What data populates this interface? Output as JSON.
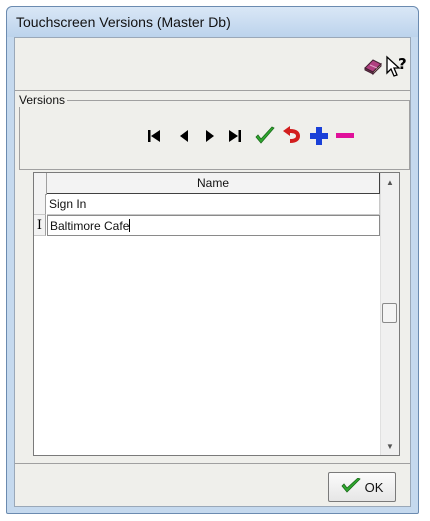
{
  "window": {
    "title": "Touchscreen Versions (Master Db)"
  },
  "toolbar": {
    "icons": [
      "book-icon",
      "help-pointer-icon"
    ],
    "help_label": "?"
  },
  "versions_group": {
    "label": "Versions"
  },
  "navigator": {
    "buttons": [
      "first-record-icon",
      "prior-record-icon",
      "next-record-icon",
      "last-record-icon",
      "post-check-icon",
      "cancel-undo-icon",
      "insert-plus-icon",
      "delete-minus-icon"
    ],
    "colors": {
      "check": "#2fa82f",
      "undo": "#d21e1e",
      "plus": "#1a40d8",
      "minus": "#e0109a"
    }
  },
  "grid": {
    "column_header": "Name",
    "rows": [
      {
        "name": "Sign In",
        "indicator": ""
      },
      {
        "name": "Baltimore Cafe",
        "indicator": "I"
      }
    ]
  },
  "footer": {
    "ok_label": "OK"
  }
}
